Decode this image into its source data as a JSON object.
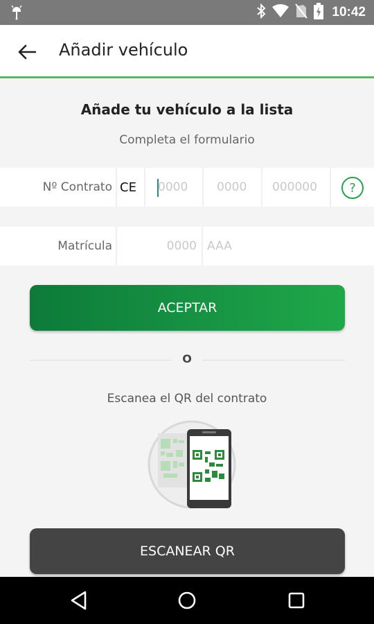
{
  "status_bar": {
    "time": "10:42",
    "icons": [
      "android-debug-icon",
      "bluetooth-icon",
      "wifi-icon",
      "no-sim-icon",
      "battery-charging-icon"
    ]
  },
  "app_bar": {
    "title": "Añadir vehículo",
    "back_icon": "arrow-left-icon"
  },
  "form": {
    "heading": "Añade tu vehículo a la lista",
    "subheading": "Completa el formulario",
    "contract": {
      "label": "Nº Contrato",
      "prefix": "CE",
      "field1_placeholder": "0000",
      "field2_placeholder": "0000",
      "field3_placeholder": "000000",
      "help_icon": "question-circle-icon"
    },
    "plate": {
      "label": "Matrícula",
      "numbers_placeholder": "0000",
      "letters_placeholder": "AAA"
    },
    "accept_label": "ACEPTAR"
  },
  "divider_text": "O",
  "scan": {
    "text": "Escanea el QR del contrato",
    "illustration_icon": "phone-scanning-qr-icon",
    "button_label": "ESCANEAR QR"
  },
  "nav_bar": {
    "icons": [
      "back-triangle-icon",
      "home-circle-icon",
      "recents-square-icon"
    ]
  },
  "colors": {
    "accent_green": "#1fa84a",
    "accent_green_dark": "#0d7a3a",
    "scan_button": "#444444",
    "status_bar": "#7a7a7a"
  }
}
